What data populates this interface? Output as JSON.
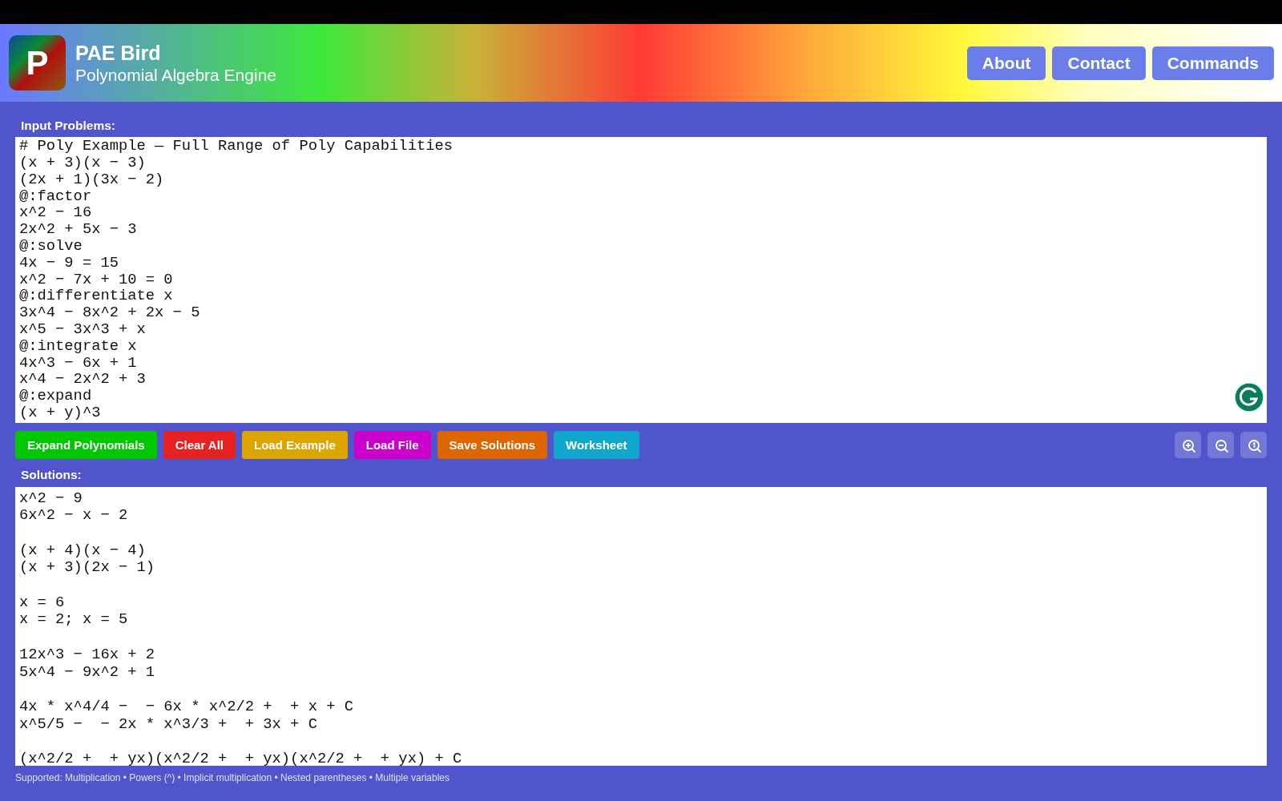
{
  "app": {
    "title": "PAE Bird",
    "subtitle": "Polynomial Algebra Engine",
    "logo_letter": "P"
  },
  "nav": [
    "About",
    "Contact",
    "Commands"
  ],
  "input": {
    "label": "Input Problems:",
    "value": "# Poly Example — Full Range of Poly Capabilities\n(x + 3)(x − 3)\n(2x + 1)(3x − 2)\n@:factor\nx^2 − 16\n2x^2 + 5x − 3\n@:solve\n4x − 9 = 15\nx^2 − 7x + 10 = 0\n@:differentiate x\n3x^4 − 8x^2 + 2x − 5\nx^5 − 3x^3 + x\n@:integrate x\n4x^3 − 6x + 1\nx^4 − 2x^2 + 3\n@:expand\n(x + y)^3"
  },
  "actions": [
    {
      "label": "Expand Polynomials",
      "color": "#00c800"
    },
    {
      "label": "Clear All",
      "color": "#e52222"
    },
    {
      "label": "Load Example",
      "color": "#dda500"
    },
    {
      "label": "Load File",
      "color": "#cc00cc"
    },
    {
      "label": "Save Solutions",
      "color": "#dd6600"
    },
    {
      "label": "Worksheet",
      "color": "#11a6cc"
    }
  ],
  "zoom_buttons": [
    {
      "kind": "zoom-in"
    },
    {
      "kind": "zoom-out"
    },
    {
      "kind": "zoom-reset"
    }
  ],
  "solutions": {
    "label": "Solutions:",
    "value": "x^2 − 9\n6x^2 − x − 2\n\n(x + 4)(x − 4)\n(x + 3)(2x − 1)\n\nx = 6\nx = 2; x = 5\n\n12x^3 − 16x + 2\n5x^4 − 9x^2 + 1\n\n4x * x^4/4 −  − 6x * x^2/2 +  + x + C\nx^5/5 −  − 2x * x^3/3 +  + 3x + C\n\n(x^2/2 +  + yx)(x^2/2 +  + yx)(x^2/2 +  + yx) + C"
  },
  "footer": "Supported: Multiplication • Powers (^) • Implicit multiplication • Nested parentheses • Multiple variables"
}
